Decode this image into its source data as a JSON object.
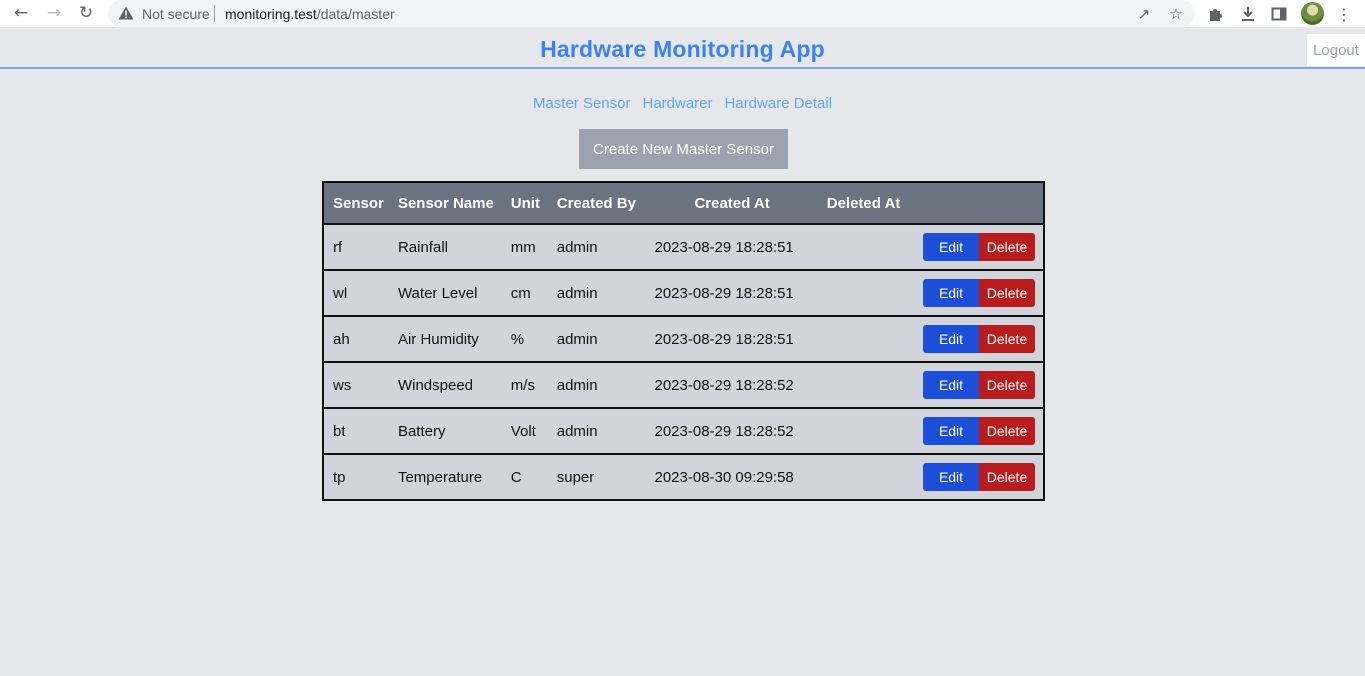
{
  "browser": {
    "not_secure": "Not secure",
    "url_host": "monitoring.test",
    "url_path": "/data/master"
  },
  "app": {
    "title": "Hardware Monitoring App",
    "logout": "Logout",
    "accent_color": "#3b82f6"
  },
  "nav": {
    "links": [
      "Master Sensor",
      "Hardwarer",
      "Hardware Detail"
    ]
  },
  "create_button": "Create New Master Sensor",
  "table": {
    "headers": [
      "Sensor",
      "Sensor Name",
      "Unit",
      "Created By",
      "Created At",
      "Deleted At"
    ],
    "edit_label": "Edit",
    "delete_label": "Delete",
    "rows": [
      {
        "sensor": "rf",
        "name": "Rainfall",
        "unit": "mm",
        "created_by": "admin",
        "created_at": "2023-08-29 18:28:51",
        "deleted_at": ""
      },
      {
        "sensor": "wl",
        "name": "Water Level",
        "unit": "cm",
        "created_by": "admin",
        "created_at": "2023-08-29 18:28:51",
        "deleted_at": ""
      },
      {
        "sensor": "ah",
        "name": "Air Humidity",
        "unit": "%",
        "created_by": "admin",
        "created_at": "2023-08-29 18:28:51",
        "deleted_at": ""
      },
      {
        "sensor": "ws",
        "name": "Windspeed",
        "unit": "m/s",
        "created_by": "admin",
        "created_at": "2023-08-29 18:28:52",
        "deleted_at": ""
      },
      {
        "sensor": "bt",
        "name": "Battery",
        "unit": "Volt",
        "created_by": "admin",
        "created_at": "2023-08-29 18:28:52",
        "deleted_at": ""
      },
      {
        "sensor": "tp",
        "name": "Temperature",
        "unit": "C",
        "created_by": "super",
        "created_at": "2023-08-30 09:29:58",
        "deleted_at": ""
      }
    ]
  }
}
